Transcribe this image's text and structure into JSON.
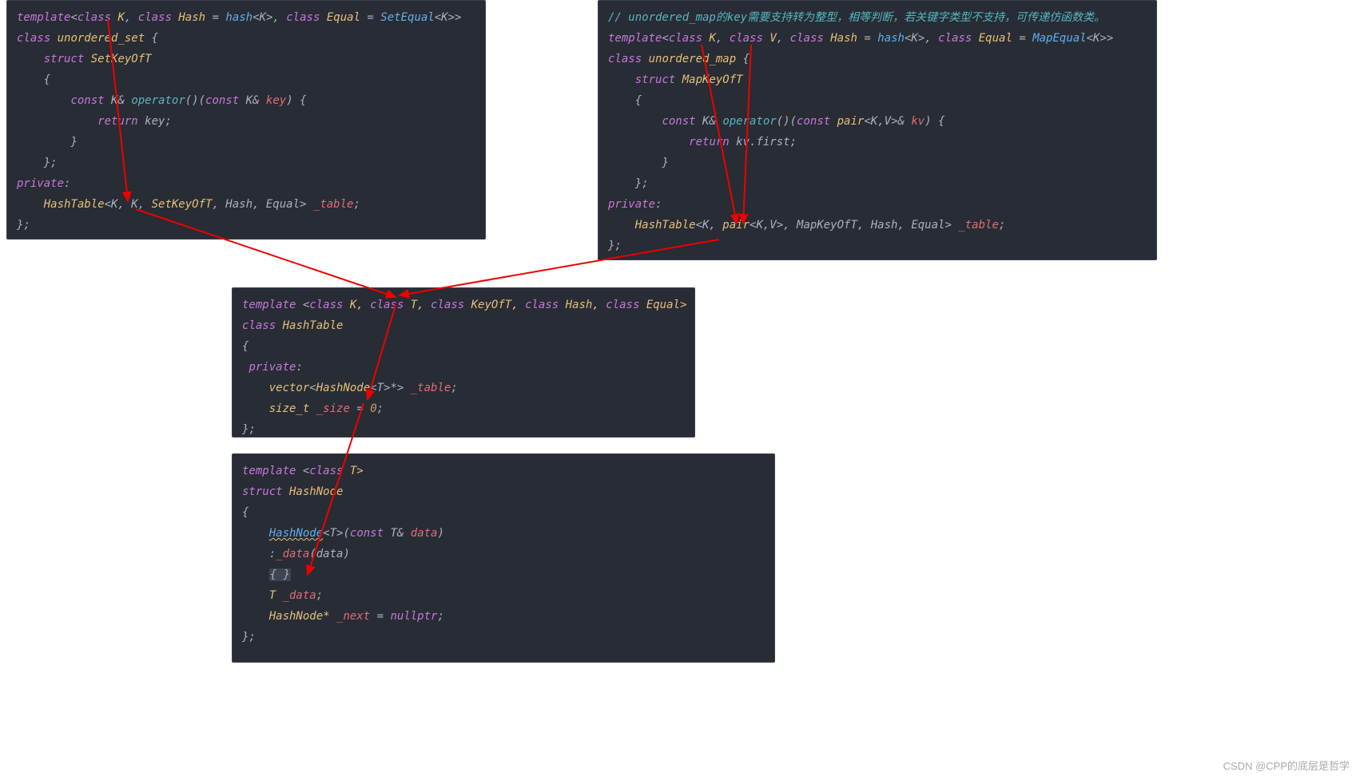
{
  "set_panel": {
    "l1_template": "template",
    "l1_class1": "class",
    "l1_K": "K",
    "l1_class2": "class",
    "l1_Hash": "Hash",
    "l1_eq1": " = ",
    "l1_hash": "hash",
    "l1_tpl1a": "<K>",
    "l1_class3": "class",
    "l1_Equal": "Equal",
    "l1_eq2": " = ",
    "l1_SetEqual": "SetEqual",
    "l1_tpl1b": "<K>>",
    "l2_class": "class",
    "l2_name": "unordered_set",
    "l2_brace": " {",
    "l3_struct": "struct",
    "l3_SetKeyOfT": "SetKeyOfT",
    "l4_brace": "{",
    "l5_const1": "const",
    "l5_Kamp": " K& ",
    "l5_operator": "operator",
    "l5_parens": "()(",
    "l5_const2": "const",
    "l5_Kamp2": " K& ",
    "l5_key": "key",
    "l5_close": ") {",
    "l6_return": "return",
    "l6_key": " key;",
    "l7_brace": "}",
    "l8_brace": "};",
    "l9_private": "private",
    "l9_colon": ":",
    "l10_HashTable": "HashTable",
    "l10_open": "<K, K, ",
    "l10_SetKeyOfT": "SetKeyOfT",
    "l10_mid": ", Hash, Equal> ",
    "l10_table": "_table",
    "l10_semi": ";",
    "l11_close": "};"
  },
  "map_panel": {
    "l0_cmt": "// unordered_map的key需要支持转为整型，相等判断，若关键字类型不支持，可传递仿函数类。",
    "l1_template": "template",
    "l1_class1": "class",
    "l1_K": "K",
    "l1_class2": "class",
    "l1_V": "V",
    "l1_class3": "class",
    "l1_Hash": "Hash",
    "l1_eq1": " = ",
    "l1_hash": "hash",
    "l1_tplK": "<K>",
    "l1_class4": "class",
    "l1_Equal": "Equal",
    "l1_eq2": " = ",
    "l1_MapEqual": "MapEqual",
    "l1_tplK2": "<K>>",
    "l2_class": "class",
    "l2_name": "unordered_map",
    "l2_brace": " {",
    "l3_struct": "struct",
    "l3_MapKeyOfT": "MapKeyOfT",
    "l4_brace": "{",
    "l5_const1": "const",
    "l5_Kamp": " K& ",
    "l5_operator": "operator",
    "l5_parens": "()(",
    "l5_const2": "const",
    "l5_pair": " pair",
    "l5_tpl": "<K,V>& ",
    "l5_kv": "kv",
    "l5_close": ") {",
    "l6_return": "return",
    "l6_kv": " kv.first;",
    "l7_brace": "}",
    "l8_brace": "};",
    "l9_private": "private",
    "l9_colon": ":",
    "l10_HashTable": "HashTable",
    "l10_open": "<K, ",
    "l10_pair": "pair",
    "l10_tpl": "<K,V>",
    "l10_mid": ", MapKeyOfT, Hash, Equal> ",
    "l10_table": "_table",
    "l10_semi": ";",
    "l11_close": "};"
  },
  "hashtable_panel": {
    "l1_template": "template",
    "l1_open": " <",
    "l1_class1": "class",
    "l1_K": " K, ",
    "l1_class2": "class",
    "l1_T": " T, ",
    "l1_class3": "class",
    "l1_KeyOfT": " KeyOfT, ",
    "l1_class4": "class",
    "l1_Hash": " Hash, ",
    "l1_class5": "class",
    "l1_Equal": " Equal>",
    "l2_class": "class",
    "l2_name": " HashTable",
    "l3_brace": "{",
    "l4_private": "private",
    "l4_colon": ":",
    "l5_vector": "vector",
    "l5_open": "<",
    "l5_HashNode": "HashNode",
    "l5_tplT": "<T>*",
    "l5_close": "> ",
    "l5_table": "_table",
    "l5_semi": ";",
    "l6_sizet": "size_t ",
    "l6_size": "_size",
    "l6_eq": " = ",
    "l6_zero": "0",
    "l6_semi": ";",
    "l7_close": "};"
  },
  "hashnode_panel": {
    "l1_template": "template",
    "l1_open": " <",
    "l1_class": "class",
    "l1_T": " T>",
    "l2_struct": "struct",
    "l2_name": " HashNode",
    "l3_brace": "{",
    "l4_HashNode": "HashNode",
    "l4_tplT": "<T>",
    "l4_open": "(",
    "l4_const": "const",
    "l4_Tamp": " T& ",
    "l4_data": "data",
    "l4_close": ")",
    "l5_colon": ":",
    "l5_data": "_data",
    "l5_open": "(",
    "l5_arg": "data",
    "l5_close": ")",
    "l6_braces": "{ }",
    "l7_T": "T ",
    "l7_data": "_data",
    "l7_semi": ";",
    "l8_HashNode": "HashNode* ",
    "l8_next": "_next",
    "l8_eq": " = ",
    "l8_null": "nullptr",
    "l8_semi": ";",
    "l9_close": "};"
  },
  "watermark": "CSDN @CPP的底层是哲学"
}
